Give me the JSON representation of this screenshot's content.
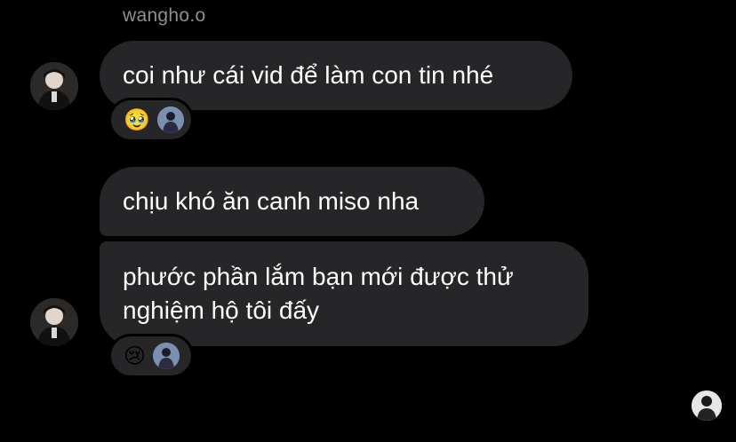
{
  "chat": {
    "sender_name": "wangho.o",
    "messages": [
      {
        "text": "coi như cái vid để làm con tin nhé",
        "reactions": [
          "🥹",
          "avatar"
        ]
      },
      {
        "text": "chịu khó ăn canh miso nha"
      },
      {
        "text": "phước phần lắm bạn mới được thử nghiệm hộ tôi đấy",
        "reactions": [
          "😢",
          "avatar"
        ]
      }
    ]
  },
  "colors": {
    "background": "#000000",
    "bubble": "#262629",
    "sender_name": "#8e8e93",
    "text": "#ffffff"
  }
}
